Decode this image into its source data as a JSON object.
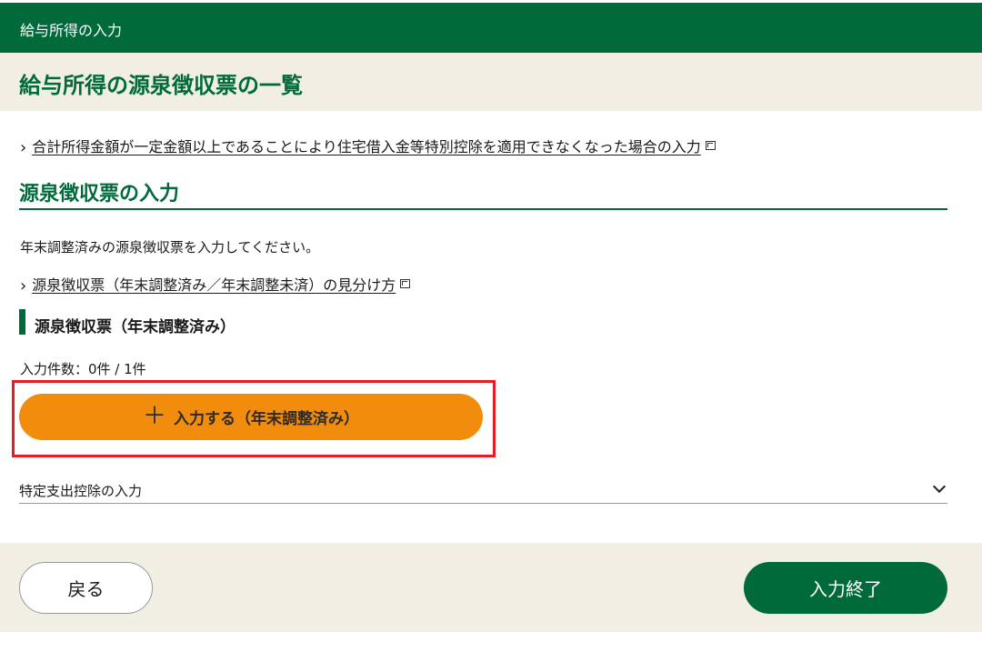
{
  "topbar": {
    "title": "給与所得の入力"
  },
  "page": {
    "title": "給与所得の源泉徴収票の一覧"
  },
  "links": {
    "housing_loan": "合計所得金額が一定金額以上であることにより住宅借入金等特別控除を適用できなくなった場合の入力",
    "distinguish": "源泉徴収票（年末調整済み／年末調整未済）の見分け方"
  },
  "section": {
    "title": "源泉徴収票の入力",
    "description": "年末調整済みの源泉徴収票を入力してください。",
    "subhead": "源泉徴収票（年末調整済み）",
    "count": "入力件数：0件 / 1件",
    "add_button_plus": "＋",
    "add_button_label": "入力する（年末調整済み）"
  },
  "accordion": {
    "label": "特定支出控除の入力"
  },
  "footer": {
    "back_label": "戻る",
    "finish_label": "入力終了"
  },
  "colors": {
    "brand_green": "#006a3a",
    "accent_orange": "#f28c0d",
    "highlight_red": "#e51c23"
  }
}
